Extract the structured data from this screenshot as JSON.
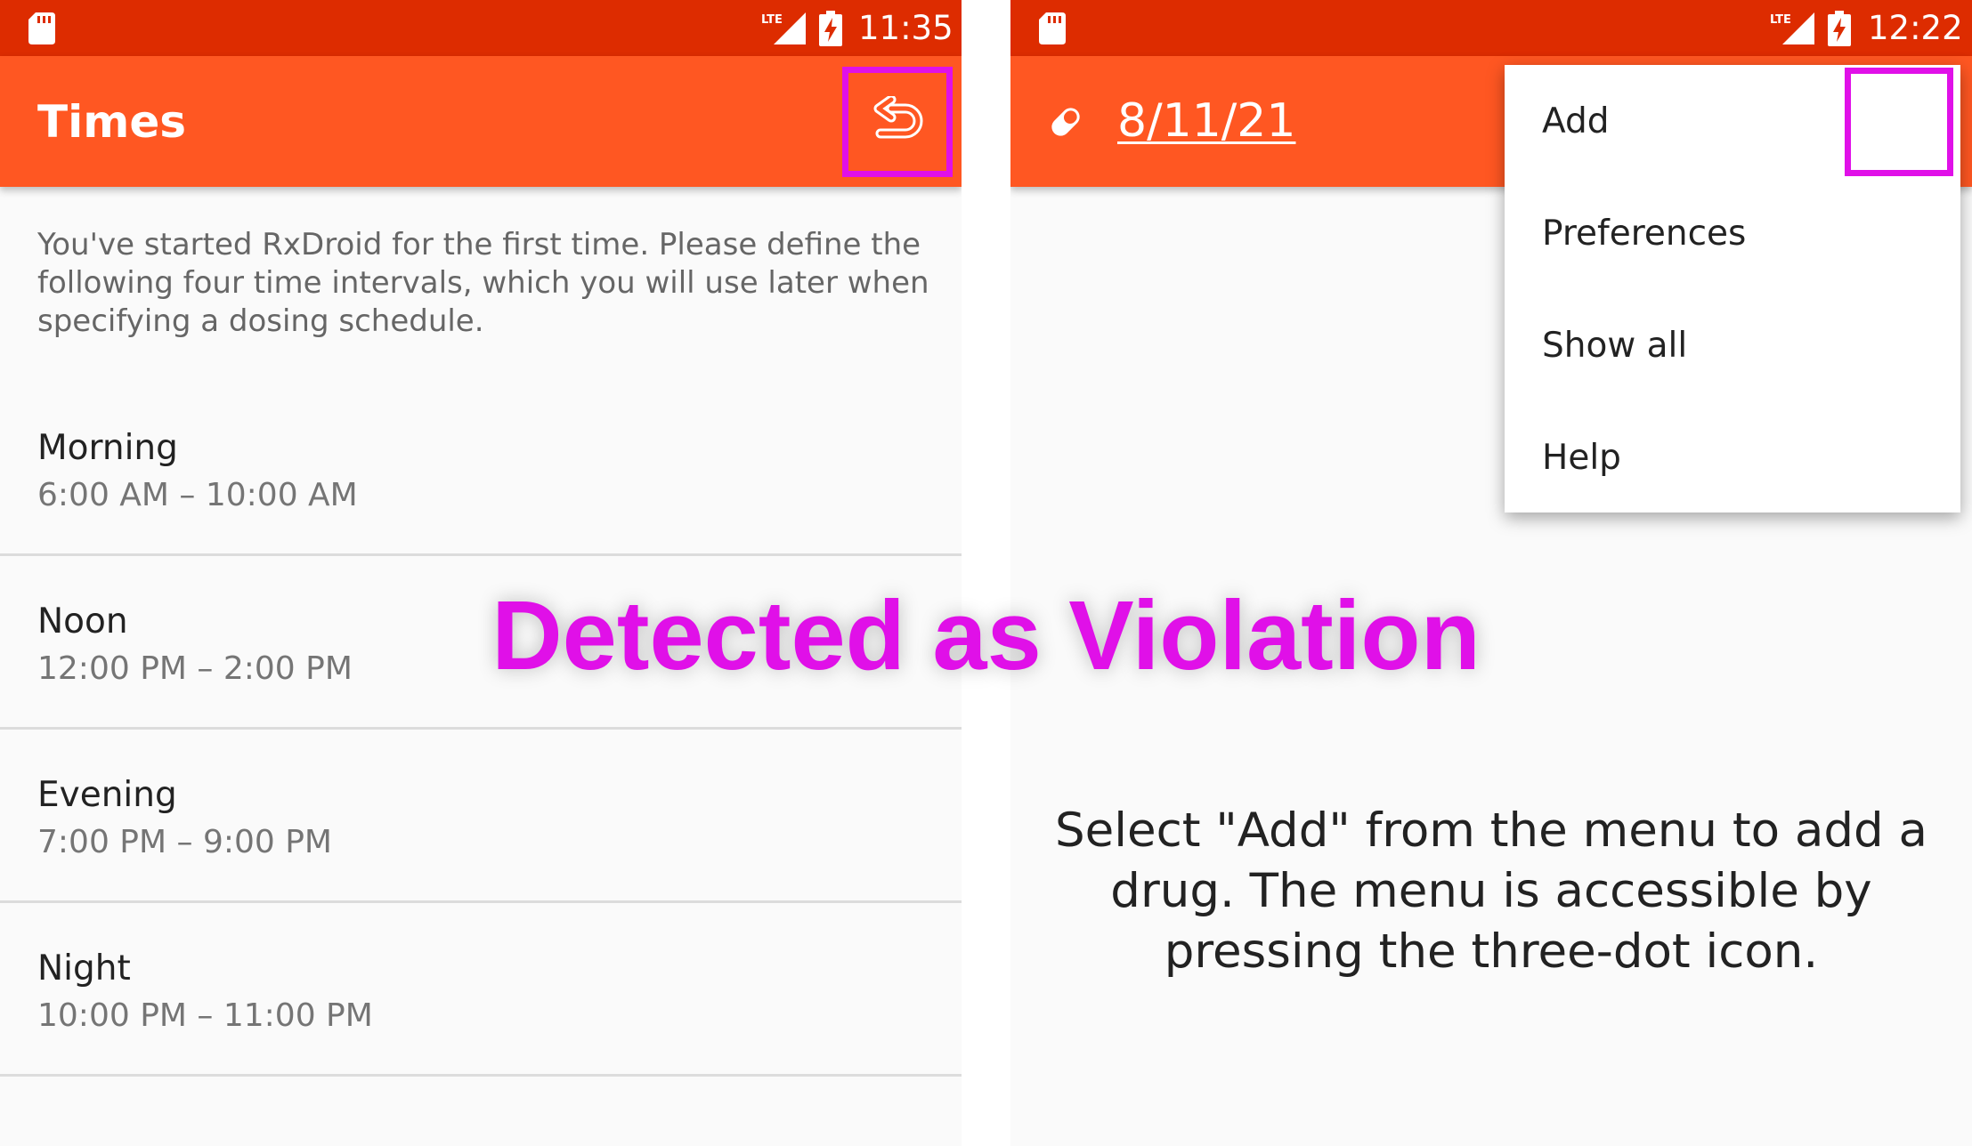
{
  "left_screen": {
    "status_bar": {
      "network_label": "LTE",
      "time": "11:35"
    },
    "app_bar": {
      "title": "Times"
    },
    "intro_text": "You've started RxDroid for the first time. Please define the following four time intervals, which you will use later when specifying a dosing schedule.",
    "time_intervals": [
      {
        "name": "Morning",
        "range": "6:00 AM – 10:00 AM"
      },
      {
        "name": "Noon",
        "range": "12:00 PM – 2:00 PM"
      },
      {
        "name": "Evening",
        "range": "7:00 PM – 9:00 PM"
      },
      {
        "name": "Night",
        "range": "10:00 PM – 11:00 PM"
      }
    ]
  },
  "right_screen": {
    "status_bar": {
      "network_label": "LTE",
      "time": "12:22"
    },
    "app_bar": {
      "date": "8/11/21"
    },
    "overflow_menu": [
      {
        "label": "Add"
      },
      {
        "label": "Preferences"
      },
      {
        "label": "Show all"
      },
      {
        "label": "Help"
      }
    ],
    "empty_hint": "Select \"Add\" from the menu to add a drug. The menu is accessible by pressing the three-dot icon."
  },
  "annotation": {
    "label": "Detected as Violation",
    "color": "#e010e8"
  },
  "colors": {
    "status_bar": "#dd2c00",
    "app_bar": "#ff5722",
    "highlight": "#e010e8",
    "background": "#fafafa"
  },
  "icons": [
    "sd-card-icon",
    "lte-signal-icon",
    "battery-charging-icon",
    "undo-icon",
    "pill-icon"
  ]
}
